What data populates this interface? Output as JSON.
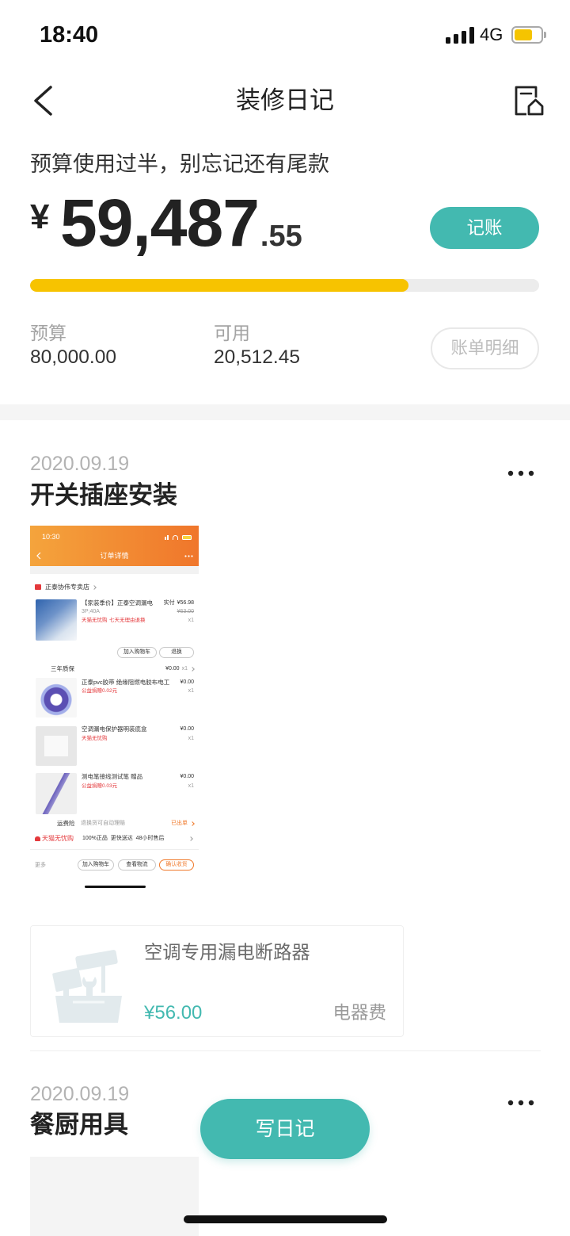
{
  "status_bar": {
    "time": "18:40",
    "network": "4G",
    "signal_icon": "signal-icon",
    "battery_icon": "battery-icon",
    "battery_level": 0.7
  },
  "header": {
    "back_icon": "chevron-left-icon",
    "title": "装修日记",
    "action_icon": "document-house-icon"
  },
  "budget": {
    "tip": "预算使用过半，别忘记还有尾款",
    "currency": "¥",
    "spent_integer": "59,487",
    "spent_decimal": ".55",
    "record_button": "记账",
    "progress": 0.744,
    "budget_label": "预算",
    "budget_value": "80,000.00",
    "available_label": "可用",
    "available_value": "20,512.45",
    "bill_detail_button": "账单明细"
  },
  "entries": [
    {
      "date": "2020.09.19",
      "title": "开关插座安装",
      "more_icon": "more-horizontal-icon",
      "photo": {
        "status_time": "10:30",
        "page_title": "订单详情",
        "shop_name": "正泰协伟专卖店",
        "main_item": {
          "title": "【家装季价】正泰空调漏电",
          "paid_label": "实付",
          "paid_price": "¥56.98",
          "spec": "3P;40A",
          "original_price": "¥63.00",
          "quantity": "x1",
          "tags": [
            "天猫无忧购",
            "七天无理由退换"
          ],
          "buttons": [
            "加入购物车",
            "退换"
          ]
        },
        "warranty": {
          "label": "三年质保",
          "price": "¥0.00",
          "quantity": "x1"
        },
        "gift_items": [
          {
            "title": "正泰pvc胶带 绝缘阻燃电胶布电工",
            "price": "¥0.00",
            "quantity": "x1",
            "note": "公益捐赠0.02元"
          },
          {
            "title": "空调漏电保护器明装底盒",
            "price": "¥0.00",
            "quantity": "x1",
            "note": "天猫无忧购"
          },
          {
            "title": "测电笔接线测试笔 赠品",
            "price": "¥0.00",
            "quantity": "x1",
            "note": "公益捐赠0.03元"
          }
        ],
        "shipping_insurance": {
          "label": "运费险",
          "description": "退换货可自动理赔",
          "status": "已出单"
        },
        "guarantee": {
          "label": "天猫无忧购",
          "description": "100%正品  更快送达  48小时售后"
        },
        "footer": {
          "more": "更多",
          "buttons": [
            "加入购物车",
            "查看物流",
            "确认收货"
          ]
        }
      },
      "expense": {
        "icon": "toolbox-icon",
        "name": "空调专用漏电断路器",
        "amount": "¥56.00",
        "category": "电器费"
      }
    },
    {
      "date": "2020.09.19",
      "title": "餐厨用具",
      "more_icon": "more-horizontal-icon"
    }
  ],
  "write_diary_button": "写日记",
  "colors": {
    "accent": "#43b9b0",
    "progress_fill": "#f7c300",
    "progress_track": "#ececec",
    "battery": "#f5c400"
  }
}
